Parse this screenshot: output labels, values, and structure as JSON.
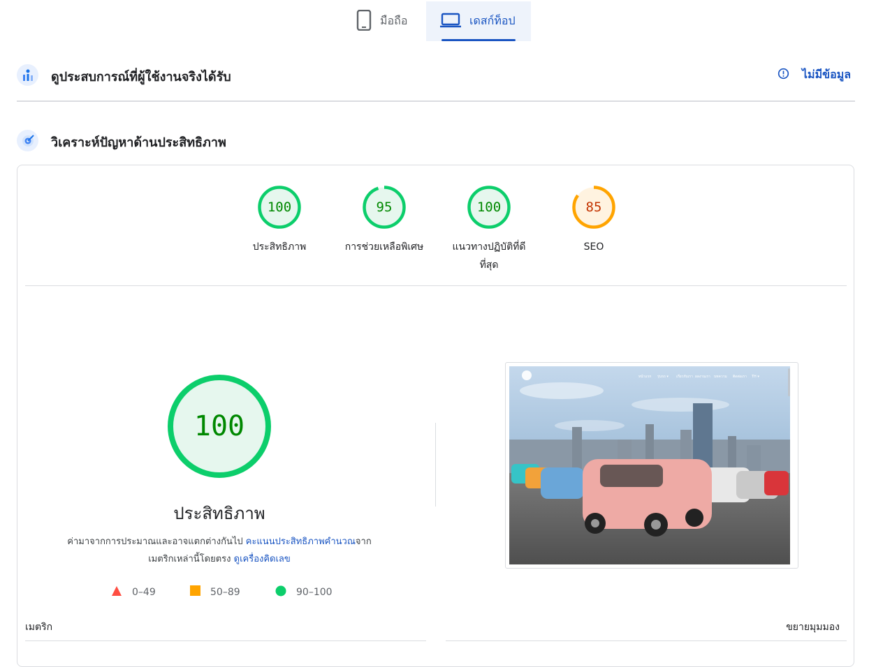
{
  "device_tabs": [
    {
      "label": "มือถือ",
      "active": false
    },
    {
      "label": "เดสก์ท็อป",
      "active": true
    }
  ],
  "field_data": {
    "title": "ดูประสบการณ์ที่ผู้ใช้งานจริงได้รับ",
    "status": "ไม่มีข้อมูล"
  },
  "diagnose": {
    "title": "วิเคราะห์ปัญหาด้านประสิทธิภาพ"
  },
  "scores": [
    {
      "value": 100,
      "text": "100",
      "label": "ประสิทธิภาพ",
      "color": "#0cce6b",
      "fill": "#e6f7ee",
      "text_color": "#008800"
    },
    {
      "value": 95,
      "text": "95",
      "label": "การช่วยเหลือพิเศษ",
      "color": "#0cce6b",
      "fill": "#e6f7ee",
      "text_color": "#008800"
    },
    {
      "value": 100,
      "text": "100",
      "label": "แนวทางปฏิบัติที่ดีที่สุด",
      "color": "#0cce6b",
      "fill": "#e6f7ee",
      "text_color": "#008800"
    },
    {
      "value": 85,
      "text": "85",
      "label": "SEO",
      "color": "#ffa400",
      "fill": "#fff3e0",
      "text_color": "#c33300"
    }
  ],
  "main_gauge": {
    "value": 100,
    "text": "100",
    "title": "ประสิทธิภาพ",
    "color": "#0cce6b"
  },
  "note": {
    "part1": "ค่ามาจากการประมาณและอาจแตกต่างกันไป ",
    "link1": "คะแนนประสิทธิภาพคำนวณ",
    "part2": "จาก",
    "part3": "เมตริกเหล่านี้โดยตรง ",
    "link2": "ดูเครื่องคิดเลข"
  },
  "legend": [
    {
      "range": "0–49",
      "shape": "triangle",
      "color": "#ff4e42"
    },
    {
      "range": "50–89",
      "shape": "square",
      "color": "#ffa400"
    },
    {
      "range": "90–100",
      "shape": "circle",
      "color": "#0cce6b"
    }
  ],
  "screenshot": {
    "nav": [
      "หน้าแรก",
      "รุ่นรถ ▾",
      "เกี่ยวกับเรา",
      "ผลงานเรา",
      "บทความ",
      "ติดต่อเรา",
      "TH ▾"
    ]
  },
  "footer": {
    "metrics_label": "เมตริก",
    "expand_label": "ขยายมุมมอง"
  },
  "colors": {
    "accent": "#1a55c2",
    "pass": "#0cce6b",
    "average": "#ffa400",
    "fail": "#ff4e42"
  }
}
